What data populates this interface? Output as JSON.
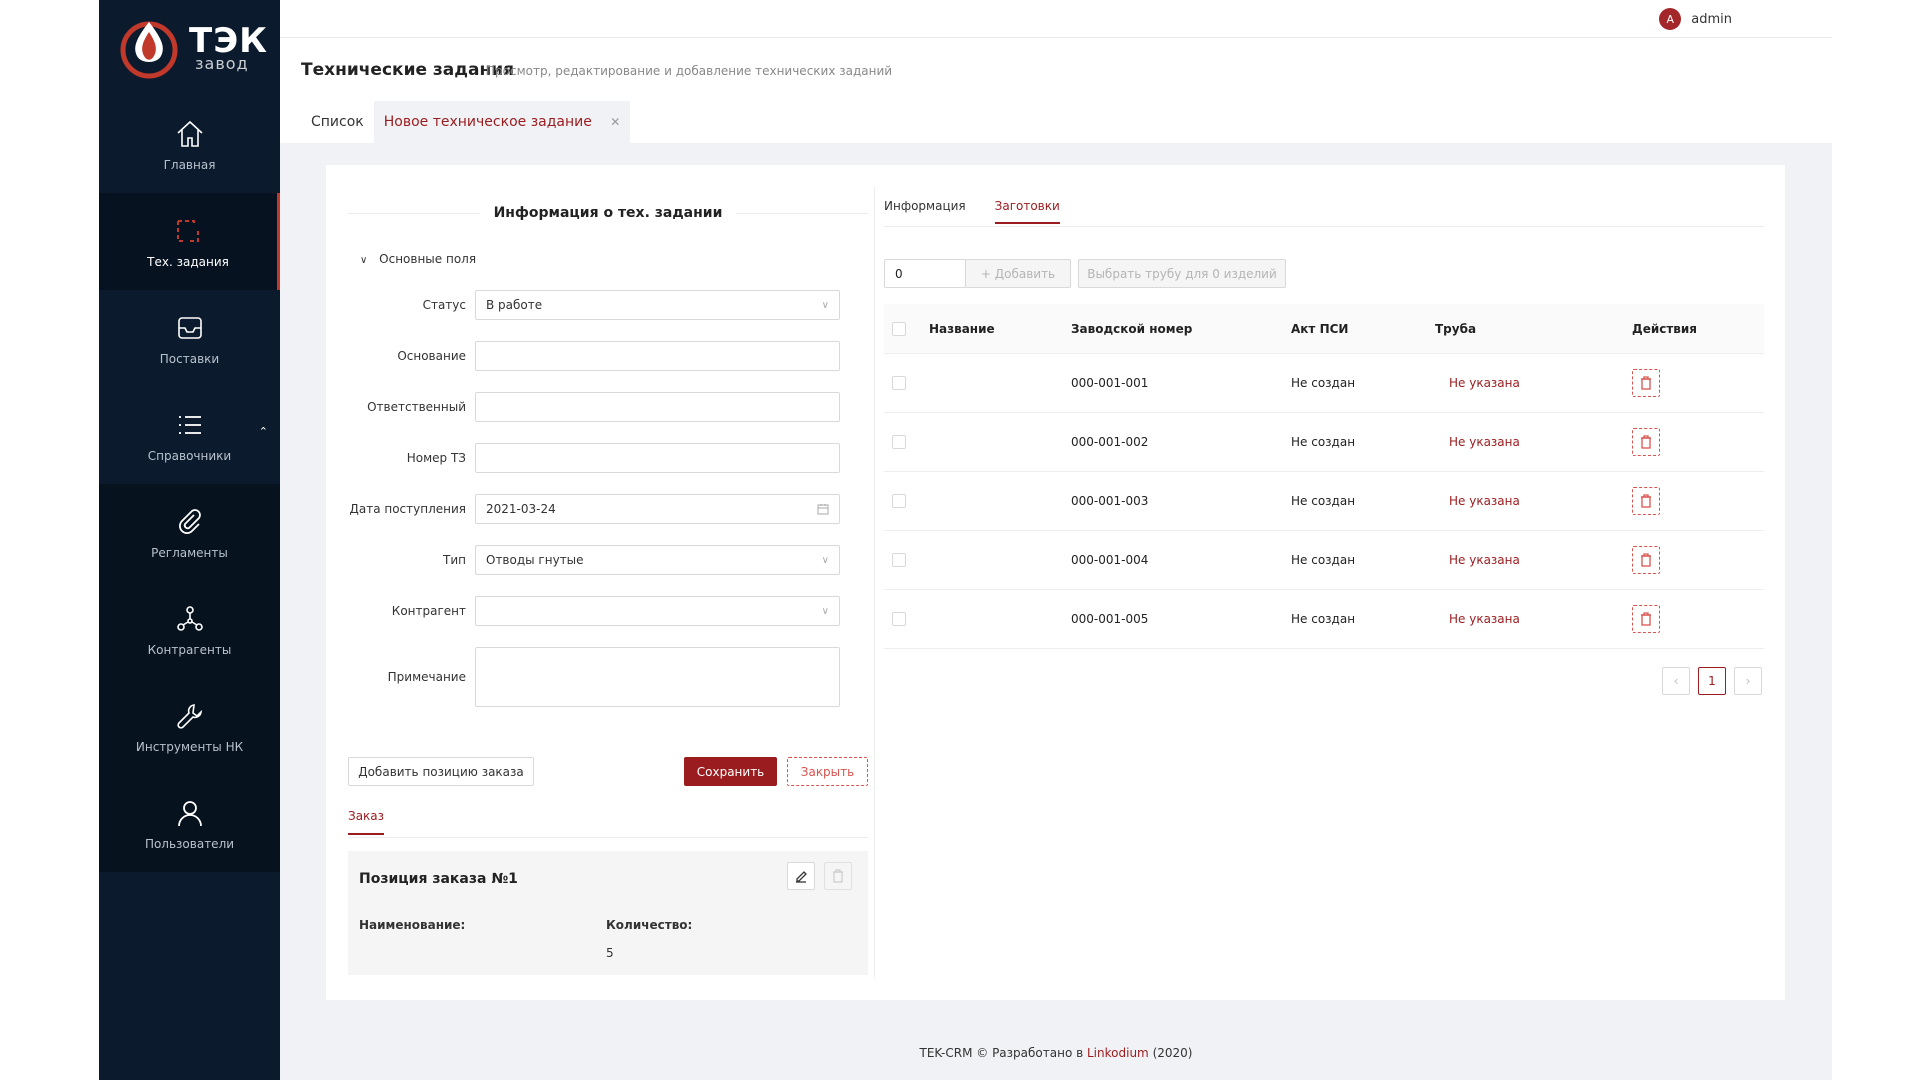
{
  "brand": {
    "title": "ТЭК",
    "subtitle": "завод",
    "accent": "#9b1c1f",
    "sidebar_bg": "#0b1b2d"
  },
  "sidebar": {
    "items": [
      {
        "label": "Главная",
        "icon": "home-icon"
      },
      {
        "label": "Тех. задания",
        "icon": "selection-icon",
        "active": true
      },
      {
        "label": "Поставки",
        "icon": "inbox-icon"
      },
      {
        "label": "Справочники",
        "icon": "list-icon",
        "expandable": true
      },
      {
        "label": "Регламенты",
        "icon": "paperclip-icon"
      },
      {
        "label": "Контрагенты",
        "icon": "network-icon"
      },
      {
        "label": "Инструменты НК",
        "icon": "wrench-icon"
      },
      {
        "label": "Пользователи",
        "icon": "user-icon"
      }
    ]
  },
  "header": {
    "avatar_letter": "A",
    "user": "admin"
  },
  "page": {
    "title": "Технические задания",
    "subtitle": "Просмотр, редактирование и добавление технических заданий",
    "tabs": [
      {
        "label": "Список"
      },
      {
        "label": "Новое техническое задание",
        "active": true,
        "closable": true
      }
    ]
  },
  "form": {
    "section_title": "Информация о тех. задании",
    "group_label": "Основные поля",
    "fields": {
      "status": {
        "label": "Статус",
        "value": "В работе"
      },
      "basis": {
        "label": "Основание",
        "value": ""
      },
      "responsible": {
        "label": "Ответственный",
        "value": ""
      },
      "tz_number": {
        "label": "Номер ТЗ",
        "value": ""
      },
      "date": {
        "label": "Дата поступления",
        "value": "2021-03-24"
      },
      "type": {
        "label": "Тип",
        "value": "Отводы гнутые"
      },
      "contractor": {
        "label": "Контрагент",
        "value": ""
      },
      "note": {
        "label": "Примечание",
        "value": ""
      }
    },
    "add_position_label": "Добавить позицию заказа",
    "save_label": "Сохранить",
    "close_label": "Закрыть"
  },
  "order": {
    "tab_label": "Заказ",
    "position_title": "Позиция заказа №1",
    "name_label": "Наименование:",
    "name_value": "",
    "qty_label": "Количество:",
    "qty_value": "5"
  },
  "right": {
    "tabs": [
      {
        "label": "Информация"
      },
      {
        "label": "Заготовки",
        "active": true
      }
    ],
    "qty_input": "0",
    "add_label": "+ Добавить",
    "choose_pipe_label": "Выбрать трубу для 0 изделий",
    "columns": [
      "Название",
      "Заводской номер",
      "Акт ПСИ",
      "Труба",
      "Действия"
    ],
    "rows": [
      {
        "name": "",
        "serial": "000-001-001",
        "act": "Не создан",
        "pipe": "Не указана"
      },
      {
        "name": "",
        "serial": "000-001-002",
        "act": "Не создан",
        "pipe": "Не указана"
      },
      {
        "name": "",
        "serial": "000-001-003",
        "act": "Не создан",
        "pipe": "Не указана"
      },
      {
        "name": "",
        "serial": "000-001-004",
        "act": "Не создан",
        "pipe": "Не указана"
      },
      {
        "name": "",
        "serial": "000-001-005",
        "act": "Не создан",
        "pipe": "Не указана"
      }
    ],
    "pagination": {
      "prev": "‹",
      "current": "1",
      "next": "›"
    }
  },
  "footer": {
    "text": "TEK-CRM © Разработано в",
    "link": "Linkodium",
    "year": "(2020)"
  }
}
